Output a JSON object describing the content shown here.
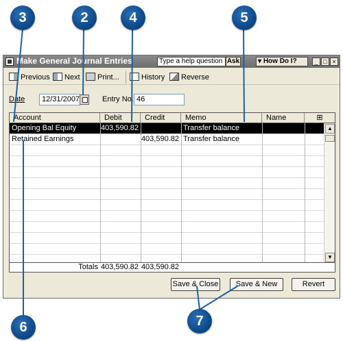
{
  "callouts": [
    "3",
    "2",
    "4",
    "5",
    "6",
    "7"
  ],
  "window": {
    "title": "Make General Journal Entries",
    "help_placeholder": "Type a help question",
    "ask_label": "Ask",
    "howdoi_label": "How Do I?"
  },
  "toolbar": {
    "previous": "Previous",
    "next": "Next",
    "print": "Print...",
    "history": "History",
    "reverse": "Reverse"
  },
  "form": {
    "date_label": "Date",
    "date_value": "12/31/2007",
    "entry_label": "Entry No.",
    "entry_value": "46"
  },
  "grid": {
    "columns": [
      "Account",
      "Debit",
      "Credit",
      "Memo",
      "Name"
    ],
    "rows": [
      {
        "account": "Opening Bal Equity",
        "debit": "403,590.82",
        "credit": "",
        "memo": "Transfer balance",
        "name": ""
      },
      {
        "account": "Retained Earnings",
        "debit": "",
        "credit": "403,590.82",
        "memo": "Transfer balance",
        "name": ""
      }
    ],
    "totals_label": "Totals",
    "total_debit": "403,590.82",
    "total_credit": "403,590.82"
  },
  "buttons": {
    "save_close": "Save & Close",
    "save_new": "Save & New",
    "revert": "Revert"
  }
}
